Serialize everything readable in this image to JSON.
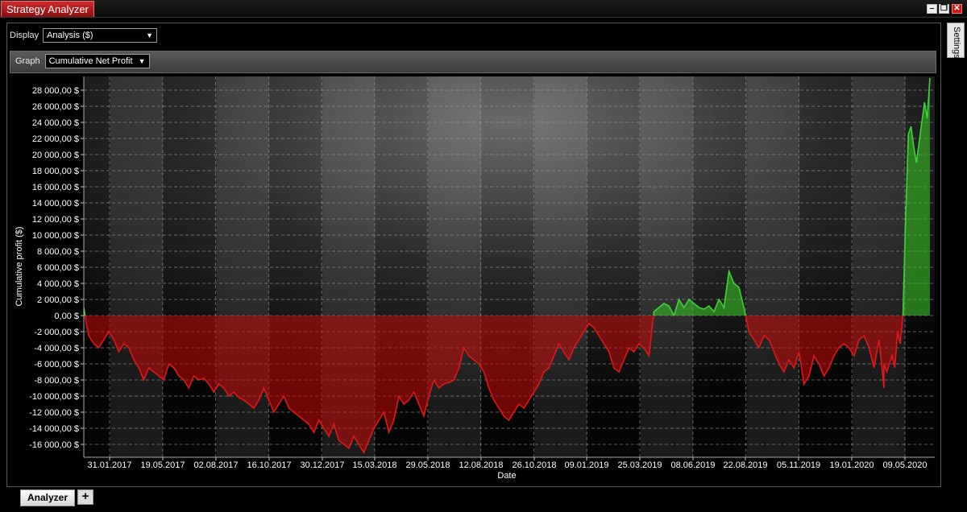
{
  "window": {
    "title": "Strategy Analyzer"
  },
  "controls": {
    "display_label": "Display",
    "display_value": "Analysis ($)",
    "graph_label": "Graph",
    "graph_value": "Cumulative Net Profit"
  },
  "side_tab": {
    "label": "Settings"
  },
  "bottom_tabs": {
    "analyzer_label": "Analyzer",
    "add_label": "+"
  },
  "colors": {
    "profit": "#3fd13a",
    "loss": "#e01818",
    "title_tab": "#b01c1c"
  },
  "chart_data": {
    "type": "area",
    "xlabel": "Date",
    "ylabel": "Cumulative profit ($)",
    "ylim": [
      -17000,
      30000
    ],
    "y_ticks": [
      28000,
      26000,
      24000,
      22000,
      20000,
      18000,
      16000,
      14000,
      12000,
      10000,
      8000,
      6000,
      4000,
      2000,
      0,
      -2000,
      -4000,
      -6000,
      -8000,
      -10000,
      -12000,
      -14000,
      -16000
    ],
    "y_tick_labels": [
      "28 000,00 $",
      "26 000,00 $",
      "24 000,00 $",
      "22 000,00 $",
      "20 000,00 $",
      "18 000,00 $",
      "16 000,00 $",
      "14 000,00 $",
      "12 000,00 $",
      "10 000,00 $",
      "8 000,00 $",
      "6 000,00 $",
      "4 000,00 $",
      "2 000,00 $",
      "0,00 $",
      "-2 000,00 $",
      "-4 000,00 $",
      "-6 000,00 $",
      "-8 000,00 $",
      "-10 000,00 $",
      "-12 000,00 $",
      "-14 000,00 $",
      "-16 000,00 $"
    ],
    "x_tick_labels": [
      "31.01.2017",
      "19.05.2017",
      "02.08.2017",
      "16.10.2017",
      "30.12.2017",
      "15.03.2018",
      "29.05.2018",
      "12.08.2018",
      "26.10.2018",
      "09.01.2019",
      "25.03.2019",
      "08.06.2019",
      "22.08.2019",
      "05.11.2019",
      "19.01.2020",
      "09.05.2020"
    ],
    "grid": true,
    "x_range": [
      0,
      160
    ],
    "points": [
      [
        0,
        1000
      ],
      [
        0.5,
        -1000
      ],
      [
        1,
        -2500
      ],
      [
        2,
        -3500
      ],
      [
        3,
        -4000
      ],
      [
        4,
        -3000
      ],
      [
        5,
        -2000
      ],
      [
        6,
        -3000
      ],
      [
        7,
        -4500
      ],
      [
        8,
        -3500
      ],
      [
        9,
        -4000
      ],
      [
        10,
        -5500
      ],
      [
        11,
        -6500
      ],
      [
        12,
        -8000
      ],
      [
        13,
        -6500
      ],
      [
        14,
        -7000
      ],
      [
        15,
        -7500
      ],
      [
        16,
        -8000
      ],
      [
        17,
        -6000
      ],
      [
        18,
        -6500
      ],
      [
        19,
        -7500
      ],
      [
        20,
        -8000
      ],
      [
        21,
        -9000
      ],
      [
        22,
        -7500
      ],
      [
        23,
        -8000
      ],
      [
        24,
        -7800
      ],
      [
        25,
        -8500
      ],
      [
        26,
        -9500
      ],
      [
        27,
        -8500
      ],
      [
        28,
        -9000
      ],
      [
        29,
        -10000
      ],
      [
        30,
        -9500
      ],
      [
        31,
        -10200
      ],
      [
        32,
        -10500
      ],
      [
        33,
        -11000
      ],
      [
        34,
        -11500
      ],
      [
        35,
        -10500
      ],
      [
        36,
        -9000
      ],
      [
        37,
        -10500
      ],
      [
        38,
        -12000
      ],
      [
        39,
        -11000
      ],
      [
        40,
        -10000
      ],
      [
        41,
        -11500
      ],
      [
        42,
        -12000
      ],
      [
        43,
        -12500
      ],
      [
        44,
        -13000
      ],
      [
        45,
        -13500
      ],
      [
        46,
        -14500
      ],
      [
        47,
        -13000
      ],
      [
        48,
        -14000
      ],
      [
        49,
        -15000
      ],
      [
        50,
        -13500
      ],
      [
        51,
        -15500
      ],
      [
        52,
        -16000
      ],
      [
        53,
        -16500
      ],
      [
        54,
        -15000
      ],
      [
        55,
        -16000
      ],
      [
        56,
        -17000
      ],
      [
        57,
        -15500
      ],
      [
        58,
        -14000
      ],
      [
        59,
        -13000
      ],
      [
        60,
        -12000
      ],
      [
        61,
        -14500
      ],
      [
        62,
        -13000
      ],
      [
        63,
        -10000
      ],
      [
        64,
        -11000
      ],
      [
        65,
        -10500
      ],
      [
        66,
        -9500
      ],
      [
        67,
        -11000
      ],
      [
        68,
        -12500
      ],
      [
        69,
        -10000
      ],
      [
        70,
        -8000
      ],
      [
        71,
        -9000
      ],
      [
        72,
        -8500
      ],
      [
        73,
        -8300
      ],
      [
        74,
        -8000
      ],
      [
        75,
        -6500
      ],
      [
        76,
        -4000
      ],
      [
        77,
        -5000
      ],
      [
        78,
        -5500
      ],
      [
        79,
        -6000
      ],
      [
        80,
        -7000
      ],
      [
        81,
        -9000
      ],
      [
        82,
        -10500
      ],
      [
        83,
        -11500
      ],
      [
        84,
        -12500
      ],
      [
        85,
        -13000
      ],
      [
        86,
        -12000
      ],
      [
        87,
        -11000
      ],
      [
        88,
        -11500
      ],
      [
        89,
        -10500
      ],
      [
        90,
        -9500
      ],
      [
        91,
        -8500
      ],
      [
        92,
        -7000
      ],
      [
        93,
        -6500
      ],
      [
        94,
        -5000
      ],
      [
        95,
        -3500
      ],
      [
        96,
        -4500
      ],
      [
        97,
        -5500
      ],
      [
        98,
        -4000
      ],
      [
        99,
        -3000
      ],
      [
        100,
        -2000
      ],
      [
        101,
        -1000
      ],
      [
        102,
        -1500
      ],
      [
        103,
        -2500
      ],
      [
        104,
        -3500
      ],
      [
        105,
        -4500
      ],
      [
        106,
        -6500
      ],
      [
        107,
        -7000
      ],
      [
        108,
        -5500
      ],
      [
        109,
        -4000
      ],
      [
        110,
        -4500
      ],
      [
        111,
        -3500
      ],
      [
        112,
        -4000
      ],
      [
        113,
        -5000
      ],
      [
        114,
        500
      ],
      [
        115,
        1000
      ],
      [
        116,
        1500
      ],
      [
        117,
        1200
      ],
      [
        118,
        0
      ],
      [
        119,
        2000
      ],
      [
        120,
        1000
      ],
      [
        121,
        2000
      ],
      [
        122,
        1500
      ],
      [
        123,
        1000
      ],
      [
        124,
        800
      ],
      [
        125,
        1200
      ],
      [
        126,
        500
      ],
      [
        127,
        2000
      ],
      [
        128,
        1000
      ],
      [
        129,
        5500
      ],
      [
        130,
        4000
      ],
      [
        131,
        3500
      ],
      [
        132,
        1000
      ],
      [
        133,
        -2000
      ],
      [
        134,
        -3000
      ],
      [
        135,
        -4000
      ],
      [
        136,
        -2500
      ],
      [
        137,
        -3000
      ],
      [
        138,
        -4500
      ],
      [
        139,
        -6000
      ],
      [
        140,
        -7000
      ],
      [
        141,
        -5500
      ],
      [
        142,
        -6500
      ],
      [
        143,
        -4500
      ],
      [
        144,
        -8500
      ],
      [
        145,
        -7500
      ],
      [
        146,
        -5000
      ],
      [
        147,
        -6000
      ],
      [
        148,
        -7500
      ],
      [
        149,
        -6500
      ],
      [
        150,
        -5000
      ],
      [
        151,
        -4000
      ],
      [
        152,
        -3500
      ],
      [
        153,
        -4000
      ],
      [
        154,
        -5000
      ],
      [
        155,
        -3000
      ],
      [
        156,
        -2500
      ],
      [
        157,
        -4000
      ],
      [
        158,
        -6500
      ],
      [
        159,
        -3000
      ],
      [
        160,
        -9000
      ]
    ],
    "end_points": [
      [
        0,
        -6000
      ],
      [
        1,
        -7000
      ],
      [
        2,
        -6000
      ],
      [
        3,
        -5000
      ],
      [
        4,
        -6500
      ],
      [
        5,
        -2000
      ],
      [
        6,
        -3500
      ],
      [
        7,
        0
      ],
      [
        8,
        12000
      ],
      [
        9,
        22500
      ],
      [
        10,
        23500
      ],
      [
        11,
        21000
      ],
      [
        12,
        19000
      ],
      [
        13,
        21500
      ],
      [
        14,
        24000
      ],
      [
        15,
        26500
      ],
      [
        16,
        24500
      ],
      [
        17,
        29500
      ]
    ]
  }
}
